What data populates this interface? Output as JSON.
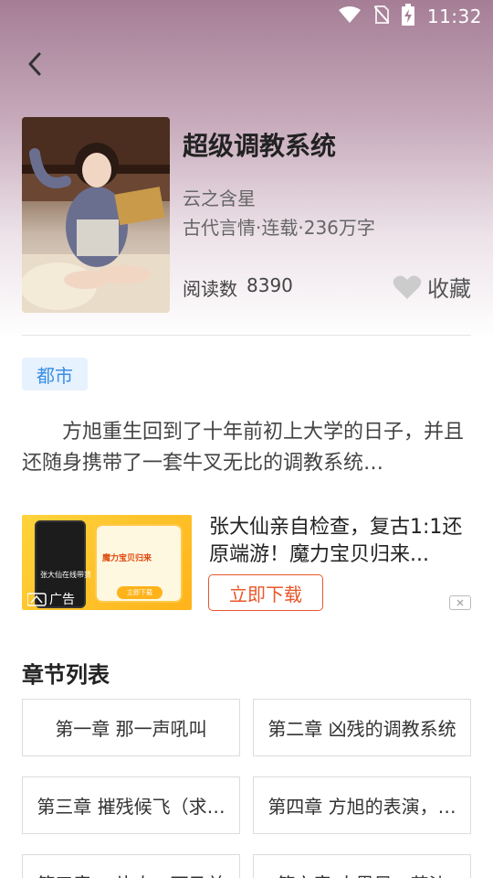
{
  "status_bar": {
    "time": "11:32"
  },
  "book": {
    "title": "超级调教系统",
    "author": "云之含星",
    "meta": "古代言情·连载·236万字",
    "read_label": "阅读数",
    "read_count": "8390",
    "favorite_label": "收藏"
  },
  "tag": "都市",
  "intro": "方旭重生回到了十年前初上大学的日子，并且还随身携带了一套牛叉无比的调教系统…",
  "ad": {
    "title": "张大仙亲自检查，复古1:1还原端游！魔力宝贝归来...",
    "download_label": "立即下载",
    "ad_label": "广告",
    "image_phone_text": "张大仙在线带货",
    "image_card_title": "魔力宝贝归来",
    "image_card_button": "立即下载"
  },
  "chapter_section_title": "章节列表",
  "chapters": [
    "第一章 那一声吼叫",
    "第二章 凶残的调教系统",
    "第三章 摧残候飞（求…",
    "第四章 方旭的表演，…",
    "第五章 一片人，下马羊",
    "第六章 大黑风，若沙"
  ],
  "colors": {
    "accent": "#e8572a",
    "tag_bg": "#e6f2fd",
    "tag_text": "#3a8ee6",
    "header_gradient_top": "#a57e96"
  }
}
